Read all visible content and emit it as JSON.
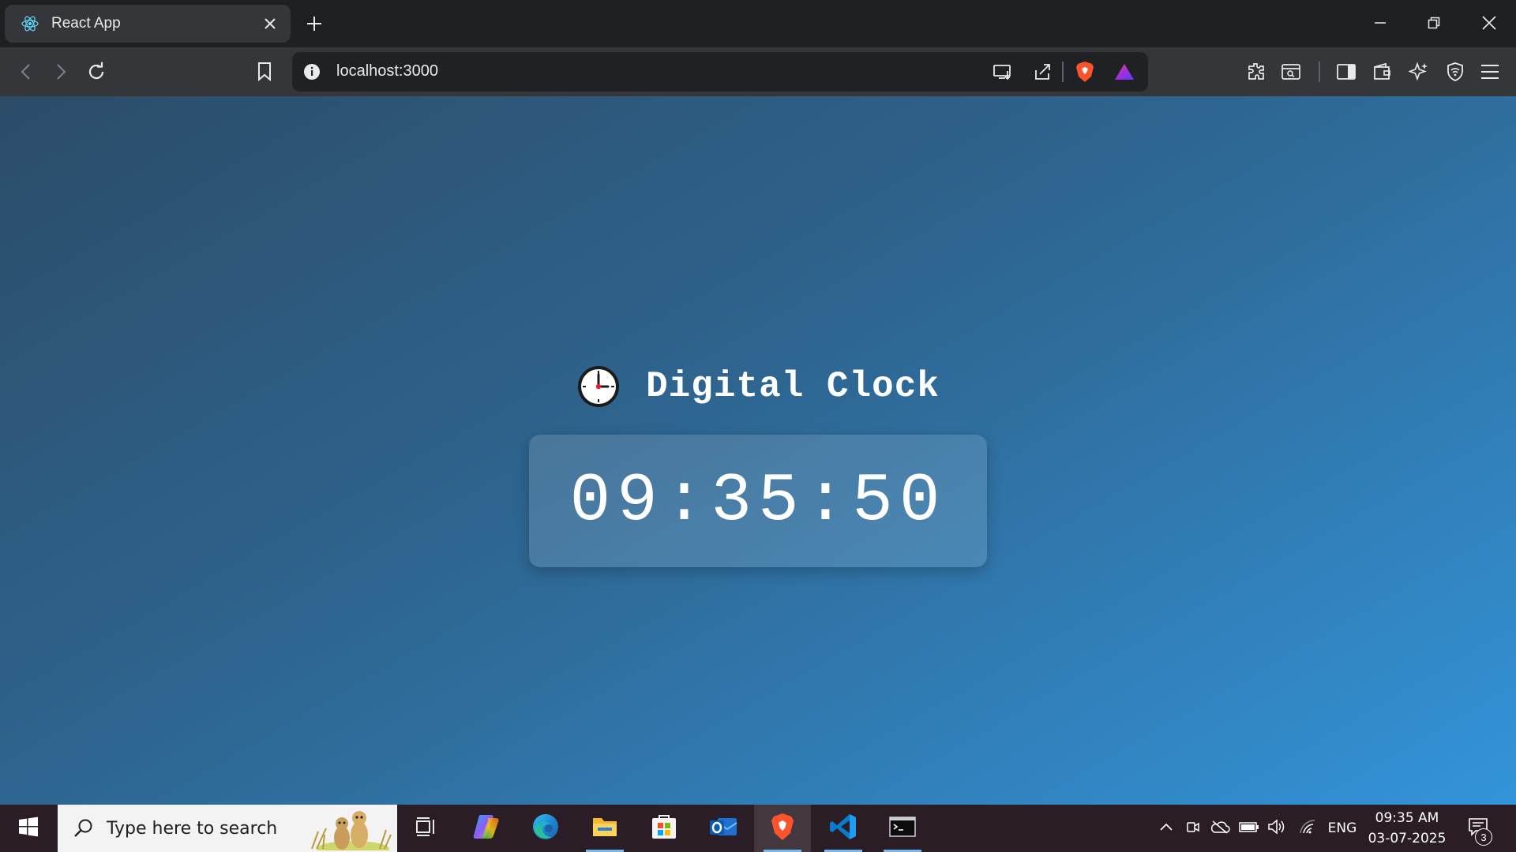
{
  "browser": {
    "tab": {
      "title": "React App",
      "favicon": "react-logo-icon"
    },
    "address": {
      "url": "localhost:3000"
    },
    "colors": {
      "tabstrip": "#1e1f22",
      "toolbar": "#35363a",
      "omnibox": "#202124"
    }
  },
  "page": {
    "heading_emoji": "clock-three-oclock-emoji",
    "heading": "Digital Clock",
    "time": "09:35:50",
    "colors": {
      "gradient_start": "#2c4c68",
      "gradient_end": "#3394d9",
      "text": "#ffffff"
    }
  },
  "taskbar": {
    "search_placeholder": "Type here to search",
    "apps": [
      "task-view-icon",
      "copilot-icon",
      "edge-icon",
      "file-explorer-icon",
      "microsoft-store-icon",
      "outlook-icon",
      "brave-icon",
      "vscode-icon",
      "terminal-icon"
    ],
    "tray": {
      "language": "ENG",
      "time": "09:35 AM",
      "date": "03-07-2025",
      "notification_count": "3"
    }
  }
}
